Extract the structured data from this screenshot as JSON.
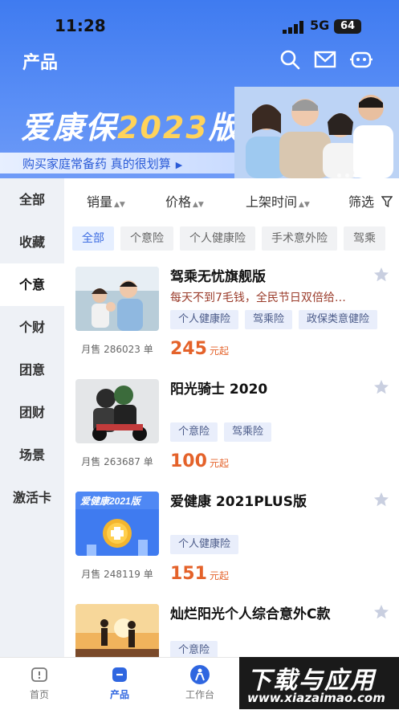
{
  "status": {
    "time": "11:28",
    "network": "5G",
    "battery": "64"
  },
  "header": {
    "title": "产品",
    "icons": [
      "search-icon",
      "mail-icon",
      "robot-icon"
    ]
  },
  "banner": {
    "title_main": "爱康保",
    "title_year": "2023",
    "title_suffix": "版",
    "subtitle": "购买家庭常备药 真的很划算",
    "arrow": "▶"
  },
  "sidebar": {
    "items": [
      "全部",
      "收藏",
      "个意",
      "个财",
      "团意",
      "团财",
      "场景",
      "激活卡"
    ],
    "active_index": 2
  },
  "sort_bar": {
    "items": [
      {
        "label": "销量",
        "arrow": "⬩"
      },
      {
        "label": "价格",
        "arrow": "⬩"
      },
      {
        "label": "上架时间",
        "arrow": "⬩"
      },
      {
        "label": "筛选"
      }
    ]
  },
  "chips": [
    "全部",
    "个意险",
    "个人健康险",
    "手术意外险",
    "驾乘"
  ],
  "products": [
    {
      "name": "驾乘无忧旗舰版",
      "desc": "每天不到7毛钱，全民节日双倍给…",
      "tags": [
        "个人健康险",
        "驾乘险",
        "政保类意健险"
      ],
      "sold": "月售 286023 单",
      "price": "245",
      "price_unit": "元起"
    },
    {
      "name": "阳光骑士 2020",
      "desc": "",
      "tags": [
        "个意险",
        "驾乘险"
      ],
      "sold": "月售 263687 单",
      "price": "100",
      "price_unit": "元起"
    },
    {
      "name": "爱健康 2021PLUS版",
      "desc": "",
      "tags": [
        "个人健康险"
      ],
      "sold": "月售 248119 单",
      "price": "151",
      "price_unit": "元起",
      "thumb_text": "爱健康2021版"
    },
    {
      "name": "灿烂阳光个人综合意外C款",
      "desc": "",
      "tags": [
        "个意险"
      ],
      "sold": "",
      "price": "",
      "price_unit": ""
    }
  ],
  "tabbar": {
    "items": [
      {
        "label": "首页",
        "icon": "home-icon"
      },
      {
        "label": "产品",
        "icon": "product-icon"
      },
      {
        "label": "工作台",
        "icon": "workbench-icon"
      }
    ],
    "active_index": 1
  },
  "watermark": {
    "line1": "下载与应用",
    "line2": "www.xiazaimao.com"
  },
  "colors": {
    "brand": "#3f7bf0",
    "price": "#e4622a",
    "chip_active": "#3d6de2"
  }
}
